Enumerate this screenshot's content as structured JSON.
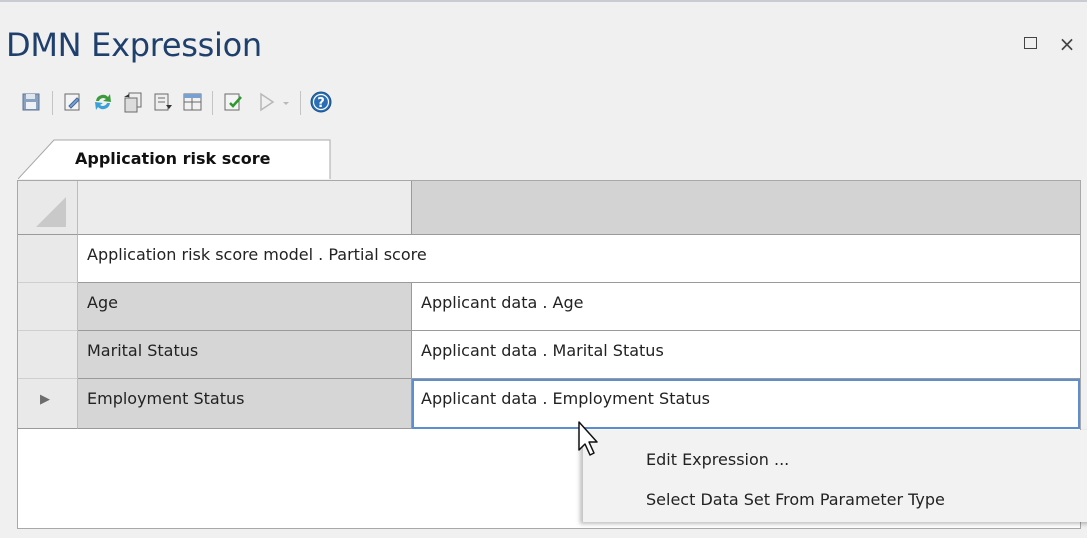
{
  "window": {
    "title": "DMN Expression",
    "maximize_glyph": "",
    "close_glyph": "×"
  },
  "toolbar": {
    "icons": [
      "save-icon",
      "edit-icon",
      "refresh-icon",
      "copy-icon",
      "load-icon",
      "table-icon",
      "validate-icon",
      "run-icon",
      "dropdown-icon",
      "help-icon"
    ]
  },
  "tab": {
    "label": "Application risk score"
  },
  "grid": {
    "title_row": "Application risk score model . Partial score",
    "rows": [
      {
        "name": "Age",
        "expression": "Applicant data . Age"
      },
      {
        "name": "Marital Status",
        "expression": "Applicant data . Marital Status"
      },
      {
        "name": "Employment Status",
        "expression": "Applicant data . Employment Status"
      }
    ],
    "current_row_marker": "▶"
  },
  "context_menu": {
    "items": [
      "Edit Expression ...",
      "Select Data Set From Parameter Type"
    ]
  },
  "colors": {
    "title": "#1f3f6c",
    "selection_outline": "#5b8fcf"
  }
}
